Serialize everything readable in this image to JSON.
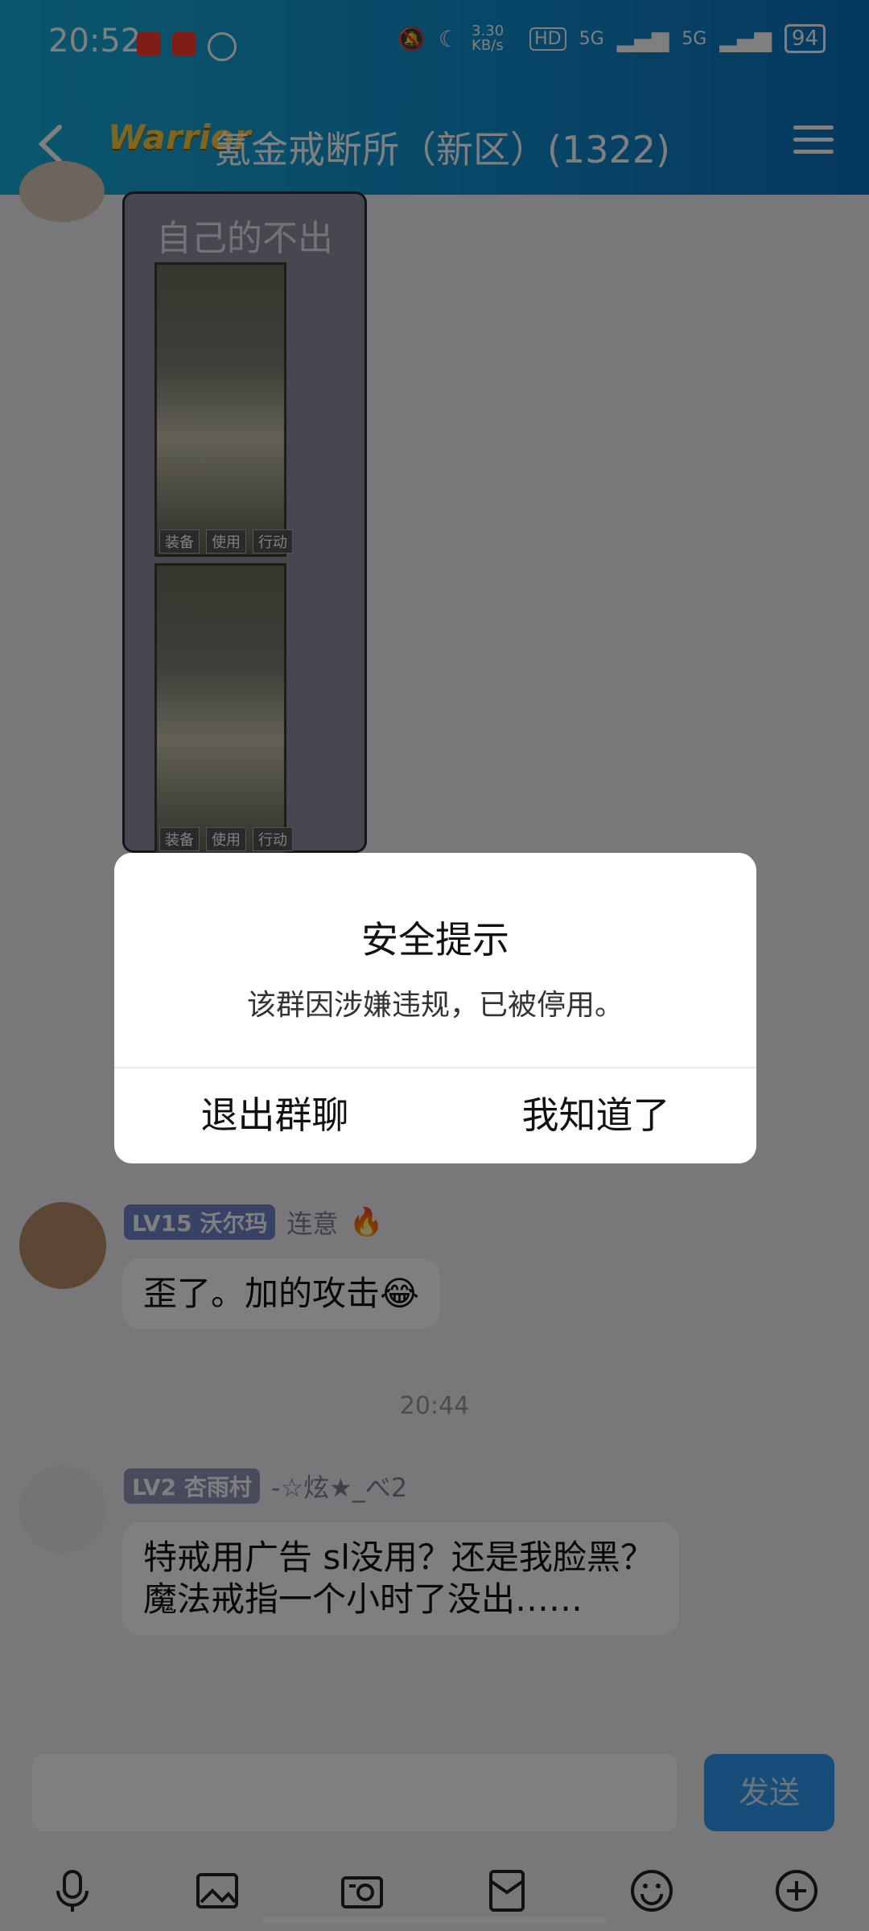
{
  "status_bar": {
    "time": "20:52",
    "net_speed": "3.30 KB/s",
    "hd": "HD",
    "sim1": "5G",
    "sim2": "5G",
    "battery": "94"
  },
  "header": {
    "logo_text": "Warrior",
    "title": "氪金戒断所（新区）(1322)"
  },
  "messages": [
    {
      "type": "image",
      "caption": "自己的不出",
      "game_buttons": [
        "装备",
        "使用",
        "行动"
      ]
    },
    {
      "type": "text",
      "level": "LV15",
      "badge_name": "沃尔玛",
      "nickname": "连意",
      "text": "歪了。加的攻击😂"
    },
    {
      "type": "time",
      "text": "20:44"
    },
    {
      "type": "text",
      "level": "LV2",
      "badge_name": "杏雨村",
      "nickname": "-☆炫★_べ2",
      "text": "特戒用广告 sl没用？还是我脸黑？魔法戒指一个小时了没出……"
    }
  ],
  "composer": {
    "send_label": "发送"
  },
  "toolbar": {
    "icons": [
      "microphone-icon",
      "image-icon",
      "camera-icon",
      "red-packet-icon",
      "emoji-icon",
      "plus-icon"
    ]
  },
  "dialog": {
    "title": "安全提示",
    "message": "该群因涉嫌违规，已被停用。",
    "exit_label": "退出群聊",
    "ok_label": "我知道了"
  },
  "colors": {
    "header_start": "#17aeda",
    "header_end": "#0b72bf",
    "send_button": "#2e9bf3",
    "overlay": "rgba(0,0,0,0.5)"
  }
}
